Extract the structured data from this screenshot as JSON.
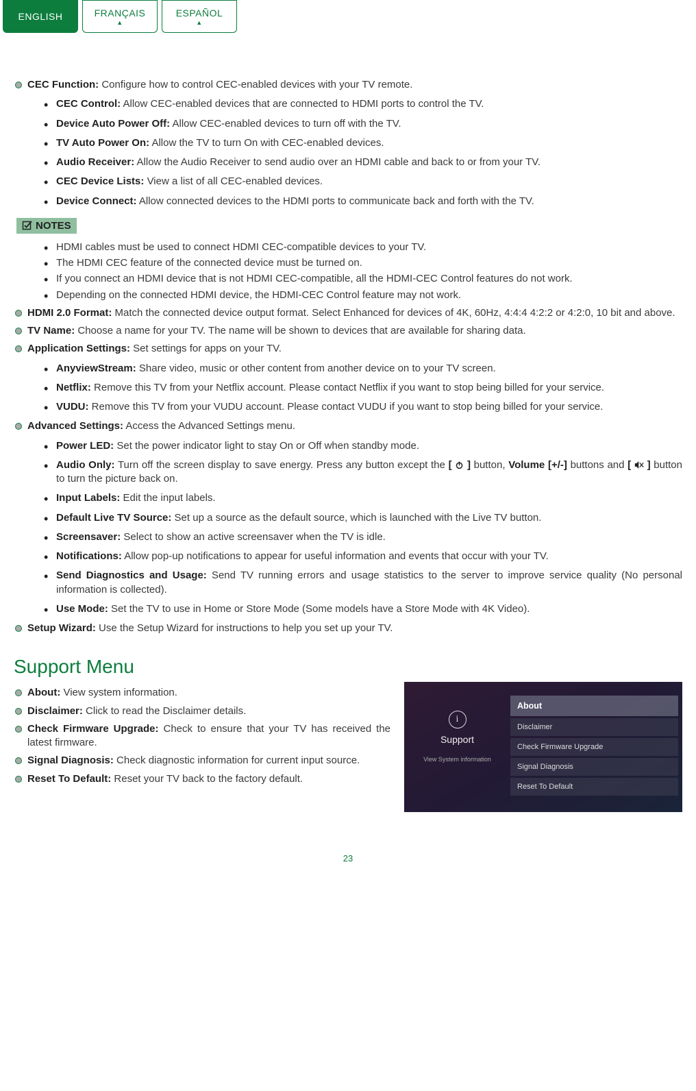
{
  "tabs": {
    "english": "ENGLISH",
    "francais": "FRANÇAIS",
    "espanol": "ESPAÑOL"
  },
  "cec": {
    "title": "CEC Function:",
    "desc": "Configure how to control CEC-enabled devices with your TV remote.",
    "items": [
      {
        "t": "CEC Control:",
        "d": "Allow CEC-enabled devices that are connected to HDMI ports to control the TV."
      },
      {
        "t": "Device Auto Power Off:",
        "d": "Allow CEC-enabled devices to turn off with the TV."
      },
      {
        "t": "TV Auto Power On:",
        "d": "Allow the TV to turn On with CEC-enabled devices."
      },
      {
        "t": "Audio Receiver:",
        "d": "Allow the Audio Receiver to send audio over an HDMI cable and back to or from your TV."
      },
      {
        "t": "CEC Device Lists:",
        "d": "View a list of all CEC-enabled devices."
      },
      {
        "t": "Device Connect:",
        "d": "Allow connected devices to the HDMI ports to communicate back and forth with the TV."
      }
    ]
  },
  "notes": {
    "label": "NOTES",
    "items": [
      "HDMI cables must be used to connect HDMI CEC-compatible devices to your TV.",
      "The HDMI CEC feature of the connected device must be turned on.",
      "If you connect an HDMI device that is not HDMI CEC-compatible, all the HDMI-CEC Control features do not work.",
      "Depending on the connected HDMI device, the HDMI-CEC Control feature may not work."
    ]
  },
  "hdmi2": {
    "t": "HDMI 2.0 Format:",
    "d": "Match the connected device output format. Select Enhanced for devices of 4K, 60Hz, 4:4:4 4:2:2 or 4:2:0, 10 bit and above."
  },
  "tvname": {
    "t": "TV Name:",
    "d": "Choose a name for your TV. The name will be shown to devices that are available for sharing data."
  },
  "apps": {
    "t": "Application Settings:",
    "d": "Set settings for apps on your TV.",
    "items": [
      {
        "t": "AnyviewStream:",
        "d": "Share video, music or other content from another device on to your TV screen."
      },
      {
        "t": "Netflix:",
        "d": "Remove this TV from your Netflix account. Please contact Netflix if you want to stop being billed for your service."
      },
      {
        "t": "VUDU:",
        "d": "Remove this TV from your VUDU account. Please contact VUDU if you want to stop being billed for your service."
      }
    ]
  },
  "adv": {
    "t": "Advanced Settings:",
    "d": "Access the Advanced Settings menu.",
    "power": {
      "t": "Power LED:",
      "d": "Set the power indicator light to stay On or Off when standby mode."
    },
    "audio": {
      "t": "Audio Only:",
      "p1": "Turn off the screen display to save energy. Press any button except the ",
      "b1a": "[ ",
      "b1b": " ]",
      "mid1": " button, ",
      "vol": "Volume [+/-]",
      "mid2": " buttons and ",
      "b2a": "[ ",
      "b2b": " ]",
      "end": " button to turn the picture back on."
    },
    "rest": [
      {
        "t": "Input Labels:",
        "d": "Edit the input labels."
      },
      {
        "t": "Default Live TV Source:",
        "d": "Set up a source as the default source, which is launched with the Live TV button."
      },
      {
        "t": "Screensaver:",
        "d": "Select to show an active screensaver when the TV is idle."
      },
      {
        "t": "Notifications:",
        "d": "Allow pop-up notifications to appear for useful information and events that occur with your TV."
      },
      {
        "t": "Send Diagnostics and Usage:",
        "d": "Send TV running errors and usage statistics to the server to improve service quality (No personal information is collected)."
      },
      {
        "t": "Use Mode:",
        "d": "Set the TV to use in Home or Store Mode (Some models have a Store Mode with 4K Video)."
      }
    ]
  },
  "setup": {
    "t": "Setup Wizard:",
    "d": "Use the Setup Wizard for instructions to help you set up your TV."
  },
  "support": {
    "heading": "Support Menu",
    "items": [
      {
        "t": "About:",
        "d": "View system information."
      },
      {
        "t": "Disclaimer:",
        "d": "Click to read the Disclaimer details."
      },
      {
        "t": "Check Firmware Upgrade:",
        "d": "Check to ensure that your TV has received the latest firmware."
      },
      {
        "t": "Signal Diagnosis:",
        "d": "Check diagnostic information for current input source."
      },
      {
        "t": "Reset To Default:",
        "d": "Reset your TV back to the factory default."
      }
    ],
    "panel": {
      "title": "Support",
      "sub": "View System information",
      "menu": [
        "About",
        "Disclaimer",
        "Check Firmware Upgrade",
        "Signal Diagnosis",
        "Reset To Default"
      ]
    }
  },
  "page": "23"
}
